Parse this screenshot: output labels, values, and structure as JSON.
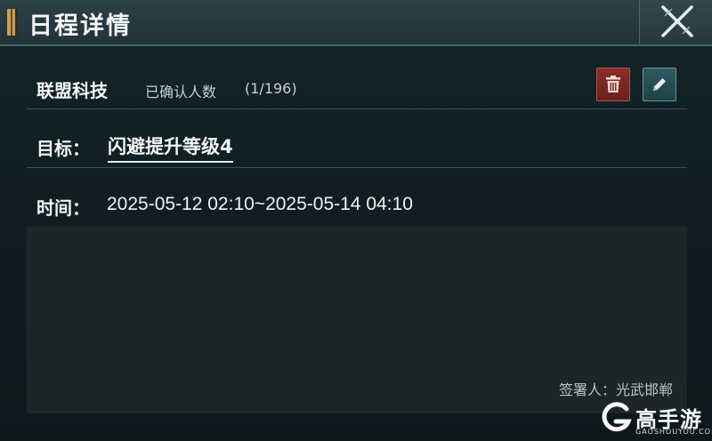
{
  "window": {
    "title": "日程详情",
    "close_icon": "close-x-icon"
  },
  "alliance": {
    "name": "联盟科技",
    "confirm_label": "已确认人数",
    "confirm_count": "(1/196)",
    "delete_icon": "trash-icon",
    "edit_icon": "pencil-icon"
  },
  "goal": {
    "label": "目标：",
    "value": "闪避提升等级4"
  },
  "time": {
    "label": "时间：",
    "value": "2025-05-12 02:10~2025-05-14 04:10"
  },
  "content": {
    "signer": "签署人：光武邯郸"
  },
  "watermark": {
    "text": "高手游",
    "sub": "GAOSHOUYOU.COM"
  },
  "colors": {
    "title_bar": "#2c4048",
    "delete_button": "#8a2e2a",
    "edit_button": "#2c5a60",
    "background": "#0f1a1d",
    "panel": "#1c2629"
  }
}
